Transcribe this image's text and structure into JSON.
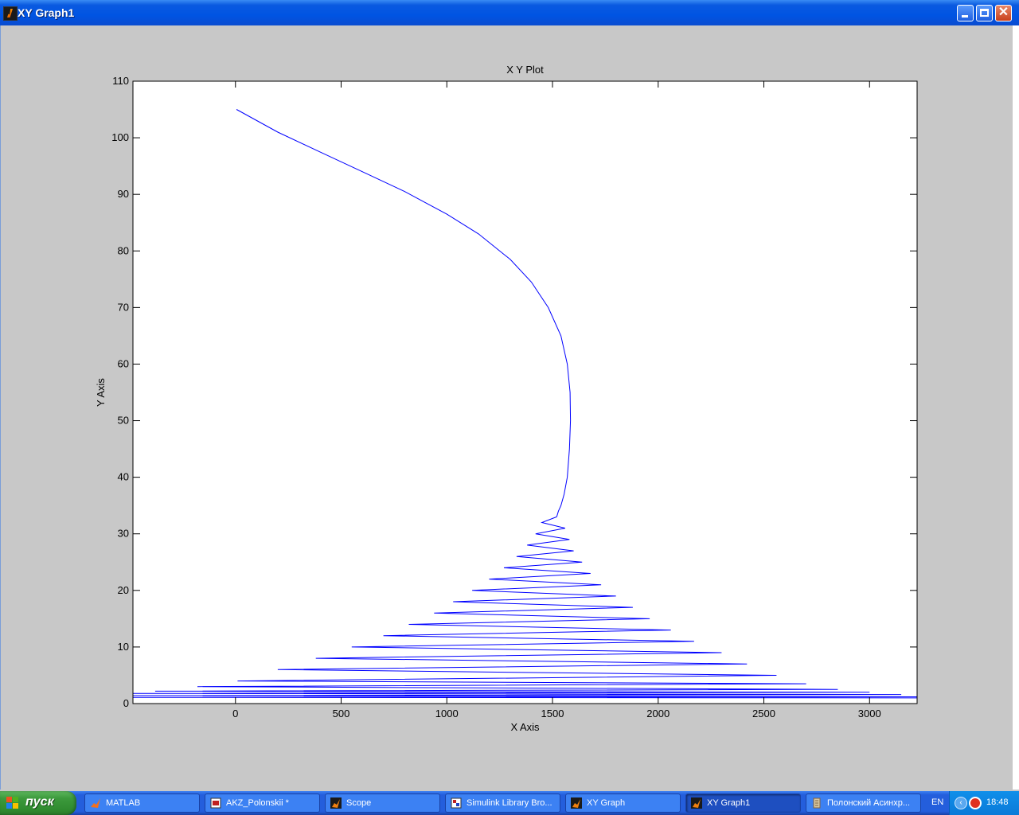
{
  "window": {
    "title": "XY Graph1",
    "icon": "matlab-icon"
  },
  "controls": {
    "minimize": "minimize-icon",
    "maximize": "maximize-icon",
    "close": "close-icon"
  },
  "chart_data": {
    "type": "line",
    "title": "X Y Plot",
    "xlabel": "X Axis",
    "ylabel": "Y Axis",
    "xlim": [
      -485,
      3225
    ],
    "ylim": [
      0,
      110
    ],
    "xticks": [
      0,
      500,
      1000,
      1500,
      2000,
      2500,
      3000
    ],
    "yticks": [
      0,
      10,
      20,
      30,
      40,
      50,
      60,
      70,
      80,
      90,
      100,
      110
    ],
    "grid": false,
    "line_color": "#0000ff",
    "background": "#ffffff",
    "series": [
      {
        "x": [
          5,
          200,
          400,
          600,
          800,
          1000,
          1150,
          1300,
          1400,
          1480,
          1540,
          1570,
          1583,
          1585,
          1580,
          1570,
          1555,
          1540,
          1528,
          1520
        ],
        "y": [
          105,
          101,
          97.5,
          94,
          90.5,
          86.5,
          83,
          78.5,
          74.5,
          70,
          65,
          60,
          55,
          50,
          45,
          40,
          37,
          35,
          34,
          33
        ]
      },
      {
        "x": [
          1520,
          1450,
          1560,
          1420,
          1580,
          1380,
          1600,
          1330,
          1640,
          1270,
          1680,
          1200,
          1730,
          1120,
          1800,
          1030,
          1880,
          940,
          1960,
          820,
          2060,
          700,
          2170,
          550,
          2300,
          380,
          2420,
          200,
          2560,
          10,
          2700,
          -180,
          2850,
          -380,
          3000,
          -485,
          3150,
          -485,
          3225,
          -485,
          3225
        ],
        "y": [
          33,
          32,
          31,
          30,
          29,
          28,
          27,
          26,
          25,
          24,
          23,
          22,
          21,
          20,
          19,
          18,
          17,
          16,
          15,
          14,
          13,
          12,
          11,
          10,
          9,
          8,
          7,
          6,
          5,
          4,
          3.5,
          3,
          2.5,
          2.2,
          2,
          1.8,
          1.6,
          1.4,
          1.2,
          1.1,
          1
        ]
      }
    ]
  },
  "taskbar": {
    "start_label": "пуск",
    "tasks": [
      {
        "label": "MATLAB",
        "icon": "matlab-icon"
      },
      {
        "label": "AKZ_Polonskii *",
        "icon": "simulink-model-icon"
      },
      {
        "label": "Scope",
        "icon": "matlab-icon"
      },
      {
        "label": "Simulink Library Bro...",
        "icon": "simulink-library-icon"
      },
      {
        "label": "XY Graph",
        "icon": "matlab-icon"
      },
      {
        "label": "XY Graph1",
        "icon": "matlab-icon"
      },
      {
        "label": "Полонский Асинхр...",
        "icon": "document-icon"
      }
    ],
    "language": "EN",
    "clock": "18:48"
  }
}
